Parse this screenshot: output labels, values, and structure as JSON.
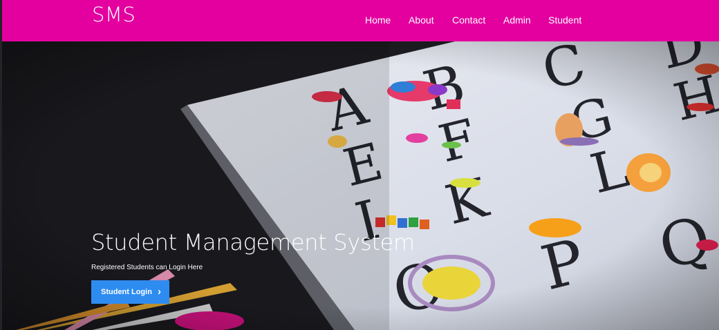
{
  "navbar": {
    "brand": "SMS",
    "links": [
      "Home",
      "About",
      "Contact",
      "Admin",
      "Student"
    ]
  },
  "hero": {
    "title": "Student Management System",
    "subtitle": "Registered Students can Login Here",
    "cta_label": "Student Login",
    "cta_icon": "chevron-right-icon",
    "background_letters": [
      "A",
      "B",
      "C",
      "D",
      "E",
      "F",
      "G",
      "H",
      "I",
      "J",
      "K",
      "L",
      "O",
      "P",
      "Q"
    ]
  },
  "colors": {
    "navbar": "#e3009f",
    "cta": "#2e8cf0",
    "background": "#1d1d22"
  }
}
